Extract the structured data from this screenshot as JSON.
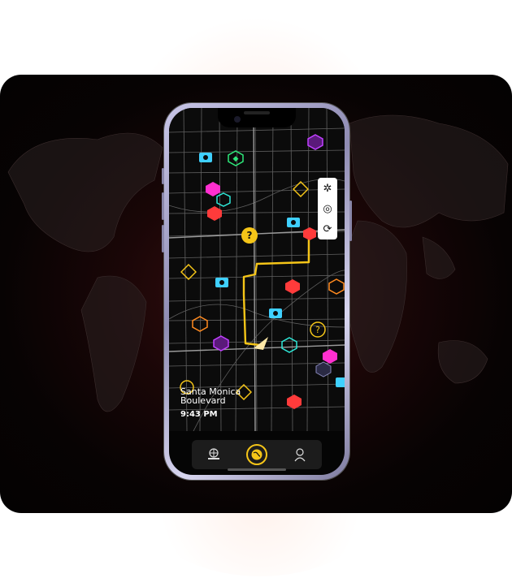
{
  "map": {
    "street_name": "Santa Monica Boulevard",
    "time": "9:43 PM",
    "route_color": "#f5c518",
    "pins": [
      {
        "icon": "shield-icon",
        "color": "#3fd0ff"
      },
      {
        "icon": "gem-icon",
        "color": "#2ee87a"
      },
      {
        "icon": "gift-icon",
        "color": "#ff2fd0"
      },
      {
        "icon": "cart-icon",
        "color": "#2ee8d8"
      },
      {
        "icon": "cube-icon",
        "color": "#ff3b3b"
      },
      {
        "icon": "question-icon",
        "color": "#f5c518"
      },
      {
        "icon": "person-icon",
        "color": "#f5c518"
      },
      {
        "icon": "alert-icon",
        "color": "#ff8a1f"
      },
      {
        "icon": "swirl-icon",
        "color": "#c040ff"
      }
    ]
  },
  "controls": {
    "items": [
      {
        "icon": "compass-icon"
      },
      {
        "icon": "locate-icon"
      },
      {
        "icon": "refresh-icon"
      }
    ]
  },
  "nav": {
    "items": [
      {
        "icon": "web-laptop-icon",
        "active": false
      },
      {
        "icon": "globe-icon",
        "active": true
      },
      {
        "icon": "hacker-avatar-icon",
        "active": false
      }
    ]
  },
  "colors": {
    "background": "#050505",
    "accent": "#f5c518",
    "phone_frame": "#a9a6c9"
  }
}
